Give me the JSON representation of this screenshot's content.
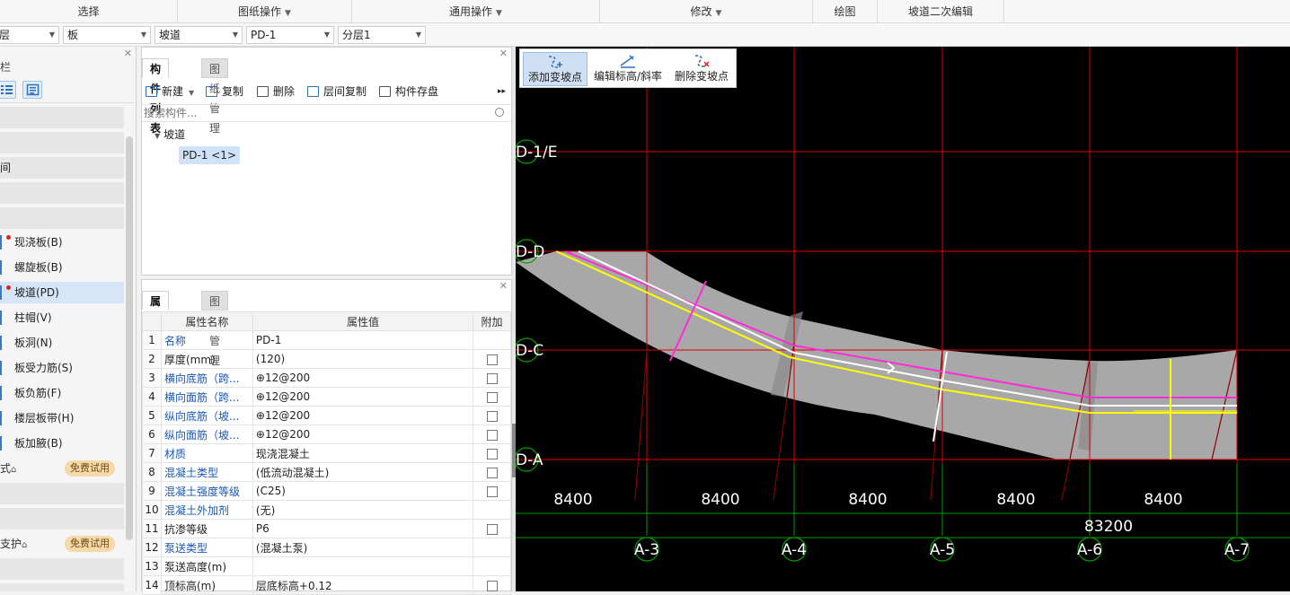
{
  "ribbon": {
    "select": "选择",
    "drawing_ops": "图纸操作",
    "common_ops": "通用操作",
    "modify": "修改",
    "draw": "绘图",
    "ramp_edit": "坡道二次编辑"
  },
  "selectors": {
    "floor": "层",
    "category": "板",
    "type": "坡道",
    "component": "PD-1",
    "layer": "分层1"
  },
  "nav": {
    "title": "栏",
    "partial_1": "间",
    "items": [
      {
        "label": "现浇板(B)",
        "dot": true
      },
      {
        "label": "螺旋板(B)",
        "dot": false
      },
      {
        "label": "坡道(PD)",
        "dot": true
      },
      {
        "label": "柱帽(V)",
        "dot": false
      },
      {
        "label": "板洞(N)",
        "dot": false
      },
      {
        "label": "板受力筋(S)",
        "dot": false
      },
      {
        "label": "板负筋(F)",
        "dot": false
      },
      {
        "label": "楼层板带(H)",
        "dot": false
      },
      {
        "label": "板加腋(B)",
        "dot": false
      }
    ],
    "trial_1_label": "式",
    "trial_2_label": "支护",
    "trial_badge": "免费试用"
  },
  "component_list": {
    "tab_active": "构件列表",
    "tab_other": "图纸管理",
    "toolbar": {
      "new": "新建",
      "copy": "复制",
      "delete": "删除",
      "floor_copy": "层间复制",
      "save": "构件存盘"
    },
    "search_placeholder": "搜索构件...",
    "tree_root": "坡道",
    "tree_leaf": "PD-1 <1>"
  },
  "property_list": {
    "tab_active": "属性列表",
    "tab_other": "图层管理",
    "headers": {
      "name": "属性名称",
      "value": "属性值",
      "extra": "附加"
    },
    "rows": [
      {
        "n": "1",
        "name": "名称",
        "value": "PD-1",
        "blue": true,
        "check": false
      },
      {
        "n": "2",
        "name": "厚度(mm)",
        "value": "(120)",
        "blue": false,
        "check": true
      },
      {
        "n": "3",
        "name": "横向底筋（跨...",
        "value": "⊕12@200",
        "blue": true,
        "check": true
      },
      {
        "n": "4",
        "name": "横向面筋（跨...",
        "value": "⊕12@200",
        "blue": true,
        "check": true
      },
      {
        "n": "5",
        "name": "纵向底筋（坡...",
        "value": "⊕12@200",
        "blue": true,
        "check": true
      },
      {
        "n": "6",
        "name": "纵向面筋（坡...",
        "value": "⊕12@200",
        "blue": true,
        "check": true
      },
      {
        "n": "7",
        "name": "材质",
        "value": "现浇混凝土",
        "blue": true,
        "check": true
      },
      {
        "n": "8",
        "name": "混凝土类型",
        "value": "(低流动混凝土)",
        "blue": true,
        "check": true
      },
      {
        "n": "9",
        "name": "混凝土强度等级",
        "value": "(C25)",
        "blue": true,
        "check": true
      },
      {
        "n": "10",
        "name": "混凝土外加剂",
        "value": "(无)",
        "blue": true,
        "check": false
      },
      {
        "n": "11",
        "name": "抗渗等级",
        "value": "P6",
        "blue": false,
        "check": true
      },
      {
        "n": "12",
        "name": "泵送类型",
        "value": "(混凝土泵)",
        "blue": true,
        "check": false
      },
      {
        "n": "13",
        "name": "泵送高度(m)",
        "value": "",
        "blue": false,
        "check": false
      },
      {
        "n": "14",
        "name": "顶标高(m)",
        "value": "层底标高+0.12",
        "blue": false,
        "check": true
      }
    ]
  },
  "slope_toolbar": {
    "add": "添加变坡点",
    "edit": "编辑标高/斜率",
    "delete": "删除变坡点"
  },
  "canvas": {
    "axis_rows": [
      "D-1/E",
      "D-D",
      "D-C",
      "D-A"
    ],
    "axis_cols": [
      "A-3",
      "A-4",
      "A-5",
      "A-6",
      "A-7"
    ],
    "dims": [
      "8400",
      "8400",
      "8400",
      "8400",
      "8400"
    ],
    "total_dim": "83200"
  },
  "colors": {
    "grid": "#e00000",
    "dim_line": "#00a000",
    "slab": "#a8a8a8",
    "magenta": "#ff2bd6",
    "yellow": "#ffff00",
    "accent": "#2f6fb9"
  }
}
